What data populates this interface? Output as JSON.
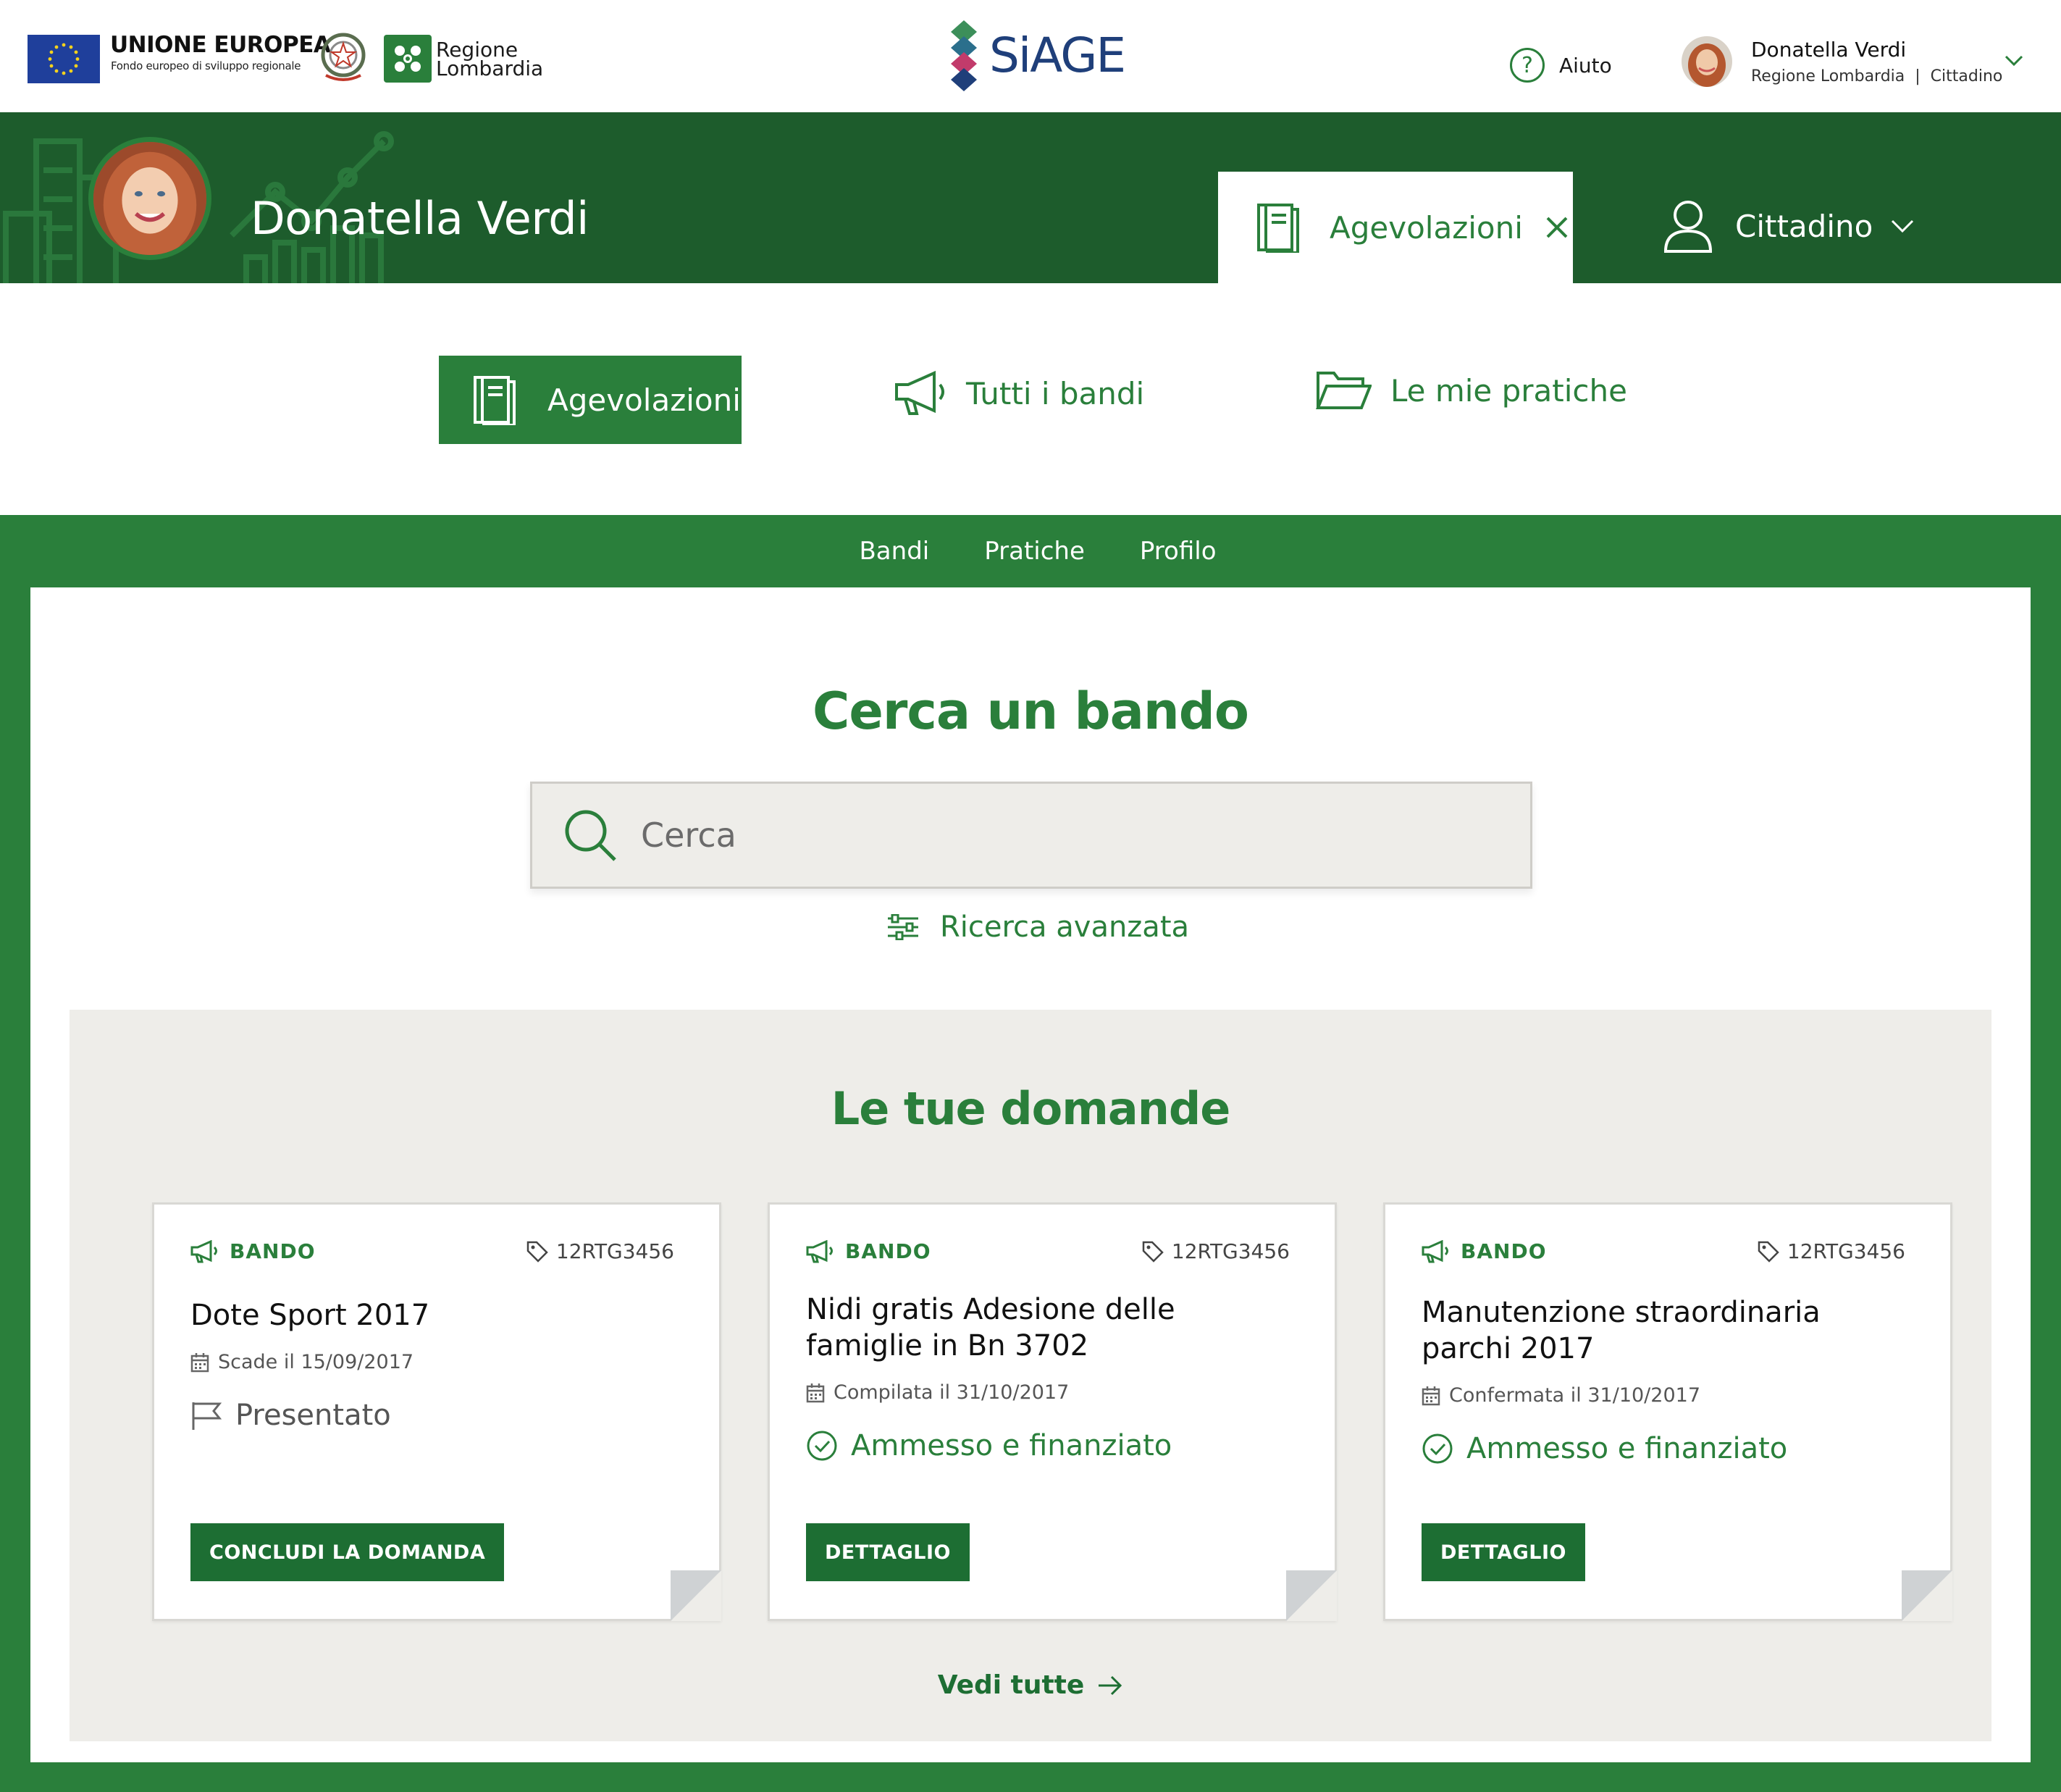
{
  "header": {
    "eu_title": "UNIONE EUROPEA",
    "eu_subtitle": "Fondo europeo di sviluppo regionale",
    "region_name_line1": "Regione",
    "region_name_line2": "Lombardia",
    "app_name": "SiAGE",
    "help_label": "Aiuto",
    "user_name": "Donatella Verdi",
    "user_org": "Regione Lombardia",
    "user_role": "Cittadino"
  },
  "profile": {
    "name": "Donatella Verdi",
    "active_tab": "Agevolazioni",
    "role_tab": "Cittadino"
  },
  "section_nav": {
    "items": [
      {
        "label": "Agevolazioni",
        "icon": "book-icon",
        "active": true
      },
      {
        "label": "Tutti i bandi",
        "icon": "megaphone-icon",
        "active": false
      },
      {
        "label": "Le mie pratiche",
        "icon": "folder-open-icon",
        "active": false
      }
    ]
  },
  "sub_nav": {
    "items": [
      "Bandi",
      "Pratiche",
      "Profilo"
    ]
  },
  "search": {
    "title": "Cerca un bando",
    "placeholder": "Cerca",
    "advanced_label": "Ricerca avanzata"
  },
  "applications": {
    "title": "Le tue domande",
    "cards": [
      {
        "kind": "BANDO",
        "code": "12RTG3456",
        "title": "Dote Sport 2017",
        "date": "Scade il 15/09/2017",
        "status": "Presentato",
        "status_icon": "flag-icon",
        "button": "CONCLUDI LA DOMANDA"
      },
      {
        "kind": "BANDO",
        "code": "12RTG3456",
        "title": "Nidi gratis Adesione delle famiglie in Bn 3702",
        "date": "Compilata il 31/10/2017",
        "status": "Ammesso e finanziato",
        "status_icon": "check-circle-icon",
        "button": "DETTAGLIO"
      },
      {
        "kind": "BANDO",
        "code": "12RTG3456",
        "title": "Manutenzione straordinaria parchi 2017",
        "date": "Confermata il 31/10/2017",
        "status": "Ammesso e finanziato",
        "status_icon": "check-circle-icon",
        "button": "DETTAGLIO"
      }
    ],
    "see_all_label": "Vedi tutte"
  },
  "colors": {
    "brand_green": "#2a7f3b",
    "dark_green": "#1d5c2c",
    "button_green": "#1d6e33",
    "panel_gray": "#eeede9",
    "siage_blue": "#1f3f7a"
  }
}
